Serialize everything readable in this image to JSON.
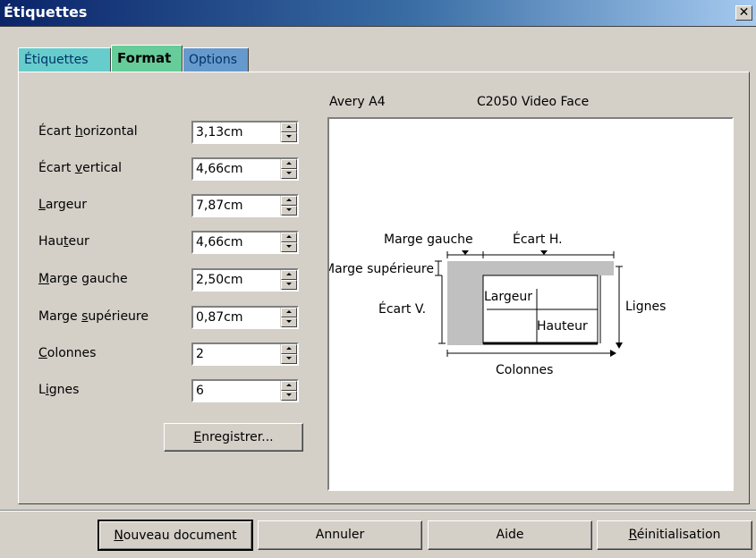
{
  "window": {
    "title": "Étiquettes",
    "close_icon": "✕"
  },
  "tabs": [
    {
      "label": "Étiquettes",
      "color": "#66cccc"
    },
    {
      "label": "Format",
      "color": "#66cc99",
      "active": true
    },
    {
      "label": "Options",
      "color": "#6699cc"
    }
  ],
  "fields": [
    {
      "label": "Écart horizontal",
      "value": "3,13cm"
    },
    {
      "label": "Écart vertical",
      "value": "4,66cm"
    },
    {
      "label": "Largeur",
      "value": "7,87cm"
    },
    {
      "label": "Hauteur",
      "value": "4,66cm"
    },
    {
      "label": "Marge gauche",
      "value": "2,50cm"
    },
    {
      "label": "Marge supérieure",
      "value": "0,87cm"
    },
    {
      "label": "Colonnes",
      "value": "2"
    },
    {
      "label": "Lignes",
      "value": "6"
    }
  ],
  "save_button": "Enregistrer...",
  "preview": {
    "brand": "Avery A4",
    "type": "C2050 Video Face",
    "labels": {
      "marge_gauche": "Marge gauche",
      "ecart_h": "Écart H.",
      "marge_superieure": "Marge supérieure",
      "ecart_v": "Écart V.",
      "largeur": "Largeur",
      "hauteur": "Hauteur",
      "lignes": "Lignes",
      "colonnes": "Colonnes"
    }
  },
  "footer": {
    "new_document": "Nouveau document",
    "cancel": "Annuler",
    "help": "Aide",
    "reset": "Réinitialisation"
  }
}
